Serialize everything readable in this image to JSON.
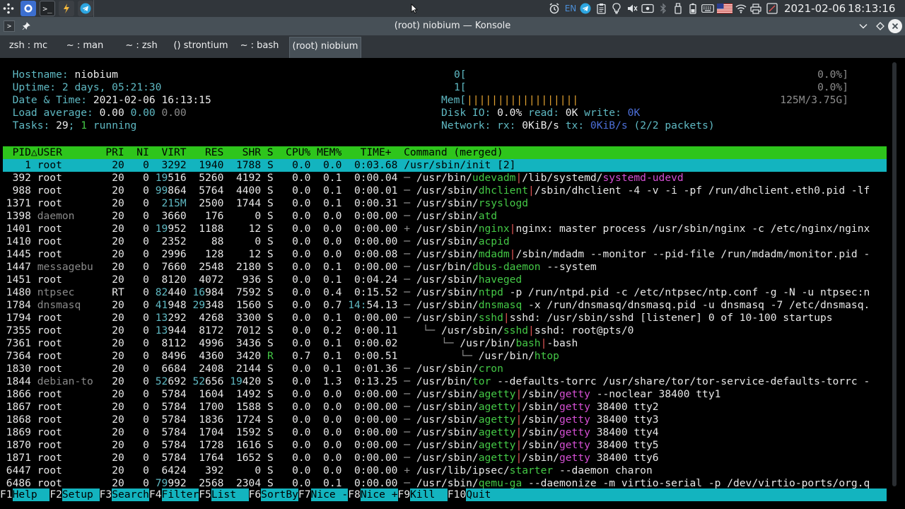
{
  "panel": {
    "clock_date": "2021-02-06",
    "clock_time": "18:13:16",
    "keyboard_layout": "EN"
  },
  "window": {
    "title": "(root) niobium — Konsole"
  },
  "tabs": [
    {
      "label": "zsh : mc"
    },
    {
      "label": "~ : man"
    },
    {
      "label": "~ : zsh"
    },
    {
      "label": "() strontium"
    },
    {
      "label": "~ : bash"
    },
    {
      "label": "(root) niobium",
      "active": true
    }
  ],
  "sysinfo": {
    "hostname_label": "Hostname:",
    "hostname": "niobium",
    "uptime_label": "Uptime:",
    "uptime": "2 days, 05:21:30",
    "datetime_label": "Date & Time:",
    "datetime": "2021-02-06 16:13:15",
    "load_label": "Load average:",
    "load1": "0.00",
    "load5": "0.00",
    "load15": "0.00",
    "tasks_label": "Tasks:",
    "tasks": "29",
    "running": "1",
    "running_label": "running"
  },
  "meters": {
    "cpu0_label": "0[",
    "cpu0_value": "0.0%]",
    "cpu1_label": "1[",
    "cpu1_value": "0.0%]",
    "mem_label": "Mem[",
    "mem_bar": "||||||||||||||||||",
    "mem_value": "125M/3.75G]",
    "disk_label": "Disk IO:",
    "disk_pct": "0.0%",
    "disk_read_label": "read:",
    "disk_read": "0K",
    "disk_write_label": "write:",
    "disk_write": "0K",
    "net_label": "Network:",
    "net_rx_label": "rx:",
    "net_rx": "0KiB/s",
    "net_tx_label": "tx:",
    "net_tx": "0KiB/s",
    "net_packets": "(2/2 packets)"
  },
  "table": {
    "header": "  PID△USER       PRI  NI  VIRT   RES   SHR S  CPU% MEM%   TIME+  Command (merged)",
    "rows": [
      {
        "pid": "1",
        "user": "root",
        "pri": "20",
        "ni": "0",
        "virt": "3292",
        "res": "1940",
        "shr": "1788",
        "s": "S",
        "cpu": "0.0",
        "mem": "0.0",
        "time": "0:03.68",
        "tree": "",
        "prog_dir": "/usr/sbin/",
        "prog": "init",
        "rest": " [2]",
        "selected": true
      },
      {
        "pid": "392",
        "user": "root",
        "pri": "20",
        "ni": "0",
        "virt": "19516",
        "res": "5260",
        "shr": "4192",
        "s": "S",
        "cpu": "0.0",
        "mem": "0.1",
        "time": "0:00.04",
        "tree": "─ ",
        "prog_dir": "/usr/bin/",
        "prog": "udevadm",
        "sep": "|",
        "rest": "/lib/systemd/",
        "rest_mg": "systemd-udevd"
      },
      {
        "pid": "988",
        "user": "root",
        "pri": "20",
        "ni": "0",
        "virt": "99864",
        "res": "5764",
        "shr": "4400",
        "s": "S",
        "cpu": "0.0",
        "mem": "0.1",
        "time": "0:00.01",
        "tree": "─ ",
        "prog_dir": "/usr/sbin/",
        "prog": "dhclient",
        "sep": "|",
        "rest": "/sbin/dhclient -4 -v -i -pf /run/dhclient.eth0.pid -lf"
      },
      {
        "pid": "1371",
        "user": "root",
        "pri": "20",
        "ni": "0",
        "virt": "215M",
        "res": "2500",
        "shr": "1744",
        "s": "S",
        "cpu": "0.0",
        "mem": "0.1",
        "time": "0:00.31",
        "tree": "─ ",
        "prog_dir": "/usr/sbin/",
        "prog": "rsyslogd",
        "rest": ""
      },
      {
        "pid": "1398",
        "user": "daemon",
        "pri": "20",
        "ni": "0",
        "virt": "3660",
        "res": "176",
        "shr": "0",
        "s": "S",
        "cpu": "0.0",
        "mem": "0.0",
        "time": "0:00.00",
        "tree": "─ ",
        "prog_dir": "/usr/sbin/",
        "prog": "atd",
        "rest": "",
        "dim_user": true
      },
      {
        "pid": "1401",
        "user": "root",
        "pri": "20",
        "ni": "0",
        "virt": "19952",
        "res": "1188",
        "shr": "12",
        "s": "S",
        "cpu": "0.0",
        "mem": "0.0",
        "time": "0:00.00",
        "tree": "+ ",
        "prog_dir": "/usr/sbin/",
        "prog": "nginx",
        "sep": "|",
        "rest": "nginx: master process /usr/sbin/nginx -c /etc/nginx/nginx"
      },
      {
        "pid": "1410",
        "user": "root",
        "pri": "20",
        "ni": "0",
        "virt": "2352",
        "res": "88",
        "shr": "0",
        "s": "S",
        "cpu": "0.0",
        "mem": "0.0",
        "time": "0:00.00",
        "tree": "─ ",
        "prog_dir": "/usr/sbin/",
        "prog": "acpid",
        "rest": ""
      },
      {
        "pid": "1445",
        "user": "root",
        "pri": "20",
        "ni": "0",
        "virt": "2996",
        "res": "128",
        "shr": "12",
        "s": "S",
        "cpu": "0.0",
        "mem": "0.0",
        "time": "0:00.08",
        "tree": "─ ",
        "prog_dir": "/usr/sbin/",
        "prog": "mdadm",
        "sep": "|",
        "rest": "/sbin/mdadm --monitor --pid-file /run/mdadm/monitor.pid -"
      },
      {
        "pid": "1447",
        "user": "messagebu",
        "pri": "20",
        "ni": "0",
        "virt": "7660",
        "res": "2548",
        "shr": "2180",
        "s": "S",
        "cpu": "0.0",
        "mem": "0.1",
        "time": "0:00.00",
        "tree": "─ ",
        "prog_dir": "/usr/bin/",
        "prog": "dbus-daemon",
        "rest": " --system",
        "dim_user": true
      },
      {
        "pid": "1451",
        "user": "root",
        "pri": "20",
        "ni": "0",
        "virt": "8120",
        "res": "4072",
        "shr": "936",
        "s": "S",
        "cpu": "0.0",
        "mem": "0.1",
        "time": "0:04.24",
        "tree": "─ ",
        "prog_dir": "/usr/sbin/",
        "prog": "haveged",
        "rest": ""
      },
      {
        "pid": "1480",
        "user": "ntpsec",
        "pri": "RT",
        "ni": "0",
        "virt": "82440",
        "res": "16984",
        "shr": "7592",
        "s": "S",
        "cpu": "0.0",
        "mem": "0.4",
        "time": "0:15.52",
        "tree": "─ ",
        "prog_dir": "/usr/sbin/",
        "prog": "ntpd",
        "rest": " -p /run/ntpd.pid -c /etc/ntpsec/ntp.conf -g -N -u ntpsec:n",
        "dim_user": true
      },
      {
        "pid": "1784",
        "user": "dnsmasq",
        "pri": "20",
        "ni": "0",
        "virt": "41948",
        "res": "29348",
        "shr": "1560",
        "s": "S",
        "cpu": "0.0",
        "mem": "0.7",
        "time": "14:54.13",
        "tree": "─ ",
        "prog_dir": "/usr/sbin/",
        "prog": "dnsmasq",
        "rest": " -x /run/dnsmasq/dnsmasq.pid -u dnsmasq -7 /etc/dnsmasq.",
        "dim_user": true
      },
      {
        "pid": "1794",
        "user": "root",
        "pri": "20",
        "ni": "0",
        "virt": "13292",
        "res": "4268",
        "shr": "3300",
        "s": "S",
        "cpu": "0.0",
        "mem": "0.1",
        "time": "0:00.00",
        "tree": "─ ",
        "prog_dir": "/usr/sbin/",
        "prog": "sshd",
        "sep": "|",
        "rest": "sshd: /usr/sbin/sshd [listener] 0 of 10-100 startups"
      },
      {
        "pid": "7355",
        "user": "root",
        "pri": "20",
        "ni": "0",
        "virt": "13944",
        "res": "8172",
        "shr": "7012",
        "s": "S",
        "cpu": "0.0",
        "mem": "0.2",
        "time": "0:00.11",
        "tree": "   └─ ",
        "prog_dir": "/usr/sbin/",
        "prog": "sshd",
        "sep": "|",
        "rest": "sshd: root@pts/0"
      },
      {
        "pid": "7361",
        "user": "root",
        "pri": "20",
        "ni": "0",
        "virt": "8112",
        "res": "4996",
        "shr": "3436",
        "s": "S",
        "cpu": "0.0",
        "mem": "0.1",
        "time": "0:00.02",
        "tree": "      └─ ",
        "prog_dir": "/usr/bin/",
        "prog": "bash",
        "sep": "|",
        "rest": "-bash"
      },
      {
        "pid": "7364",
        "user": "root",
        "pri": "20",
        "ni": "0",
        "virt": "8496",
        "res": "4360",
        "shr": "3420",
        "s": "R",
        "cpu": "0.7",
        "mem": "0.1",
        "time": "0:00.51",
        "tree": "         └─ ",
        "prog_dir": "/usr/bin/",
        "prog": "htop",
        "rest": ""
      },
      {
        "pid": "1830",
        "user": "root",
        "pri": "20",
        "ni": "0",
        "virt": "6684",
        "res": "2408",
        "shr": "2144",
        "s": "S",
        "cpu": "0.0",
        "mem": "0.1",
        "time": "0:01.36",
        "tree": "─ ",
        "prog_dir": "/usr/sbin/",
        "prog": "cron",
        "rest": ""
      },
      {
        "pid": "1844",
        "user": "debian-to",
        "pri": "20",
        "ni": "0",
        "virt": "52692",
        "res": "52656",
        "shr": "19420",
        "s": "S",
        "cpu": "0.0",
        "mem": "1.3",
        "time": "0:13.25",
        "tree": "─ ",
        "prog_dir": "/usr/bin/",
        "prog": "tor",
        "rest": " --defaults-torrc /usr/share/tor/tor-service-defaults-torrc -",
        "dim_user": true
      },
      {
        "pid": "1866",
        "user": "root",
        "pri": "20",
        "ni": "0",
        "virt": "5784",
        "res": "1604",
        "shr": "1492",
        "s": "S",
        "cpu": "0.0",
        "mem": "0.0",
        "time": "0:00.00",
        "tree": "─ ",
        "prog_dir": "/usr/sbin/",
        "prog": "agetty",
        "sep": "|",
        "rest": "/sbin/",
        "rest_mg": "getty",
        "rest2": " --noclear 38400 tty1"
      },
      {
        "pid": "1867",
        "user": "root",
        "pri": "20",
        "ni": "0",
        "virt": "5784",
        "res": "1700",
        "shr": "1588",
        "s": "S",
        "cpu": "0.0",
        "mem": "0.0",
        "time": "0:00.00",
        "tree": "─ ",
        "prog_dir": "/usr/sbin/",
        "prog": "agetty",
        "sep": "|",
        "rest": "/sbin/",
        "rest_mg": "getty",
        "rest2": " 38400 tty2"
      },
      {
        "pid": "1868",
        "user": "root",
        "pri": "20",
        "ni": "0",
        "virt": "5784",
        "res": "1836",
        "shr": "1724",
        "s": "S",
        "cpu": "0.0",
        "mem": "0.0",
        "time": "0:00.00",
        "tree": "─ ",
        "prog_dir": "/usr/sbin/",
        "prog": "agetty",
        "sep": "|",
        "rest": "/sbin/",
        "rest_mg": "getty",
        "rest2": " 38400 tty3"
      },
      {
        "pid": "1869",
        "user": "root",
        "pri": "20",
        "ni": "0",
        "virt": "5784",
        "res": "1704",
        "shr": "1592",
        "s": "S",
        "cpu": "0.0",
        "mem": "0.0",
        "time": "0:00.00",
        "tree": "─ ",
        "prog_dir": "/usr/sbin/",
        "prog": "agetty",
        "sep": "|",
        "rest": "/sbin/",
        "rest_mg": "getty",
        "rest2": " 38400 tty4"
      },
      {
        "pid": "1870",
        "user": "root",
        "pri": "20",
        "ni": "0",
        "virt": "5784",
        "res": "1728",
        "shr": "1616",
        "s": "S",
        "cpu": "0.0",
        "mem": "0.0",
        "time": "0:00.00",
        "tree": "─ ",
        "prog_dir": "/usr/sbin/",
        "prog": "agetty",
        "sep": "|",
        "rest": "/sbin/",
        "rest_mg": "getty",
        "rest2": " 38400 tty5"
      },
      {
        "pid": "1871",
        "user": "root",
        "pri": "20",
        "ni": "0",
        "virt": "5784",
        "res": "1764",
        "shr": "1652",
        "s": "S",
        "cpu": "0.0",
        "mem": "0.0",
        "time": "0:00.00",
        "tree": "─ ",
        "prog_dir": "/usr/sbin/",
        "prog": "agetty",
        "sep": "|",
        "rest": "/sbin/",
        "rest_mg": "getty",
        "rest2": " 38400 tty6"
      },
      {
        "pid": "6447",
        "user": "root",
        "pri": "20",
        "ni": "0",
        "virt": "6424",
        "res": "392",
        "shr": "0",
        "s": "S",
        "cpu": "0.0",
        "mem": "0.0",
        "time": "0:00.00",
        "tree": "+ ",
        "prog_dir": "/usr/lib/ipsec/",
        "prog": "starter",
        "rest": " --daemon charon"
      },
      {
        "pid": "6486",
        "user": "root",
        "pri": "20",
        "ni": "0",
        "virt": "79992",
        "res": "2568",
        "shr": "2304",
        "s": "S",
        "cpu": "0.0",
        "mem": "0.1",
        "time": "0:00.00",
        "tree": "─ ",
        "prog_dir": "/usr/sbin/",
        "prog": "qemu-ga",
        "rest": " --daemonize -m virtio-serial -p /dev/virtio-ports/org.q"
      }
    ]
  },
  "fkeys": [
    {
      "key": "F1",
      "label": "Help  "
    },
    {
      "key": "F2",
      "label": "Setup "
    },
    {
      "key": "F3",
      "label": "Search"
    },
    {
      "key": "F4",
      "label": "Filter"
    },
    {
      "key": "F5",
      "label": "List  "
    },
    {
      "key": "F6",
      "label": "SortBy"
    },
    {
      "key": "F7",
      "label": "Nice -"
    },
    {
      "key": "F8",
      "label": "Nice +"
    },
    {
      "key": "F9",
      "label": "Kill  "
    },
    {
      "key": "F10",
      "label": "Quit"
    }
  ],
  "colors": {
    "header_bg": "#2ec51c",
    "selected_bg": "#13b4bf",
    "label_cyan": "#5fb9c3",
    "value_blue": "#4c6fd8",
    "prog_green": "#44c946",
    "magenta": "#d54fd4"
  }
}
